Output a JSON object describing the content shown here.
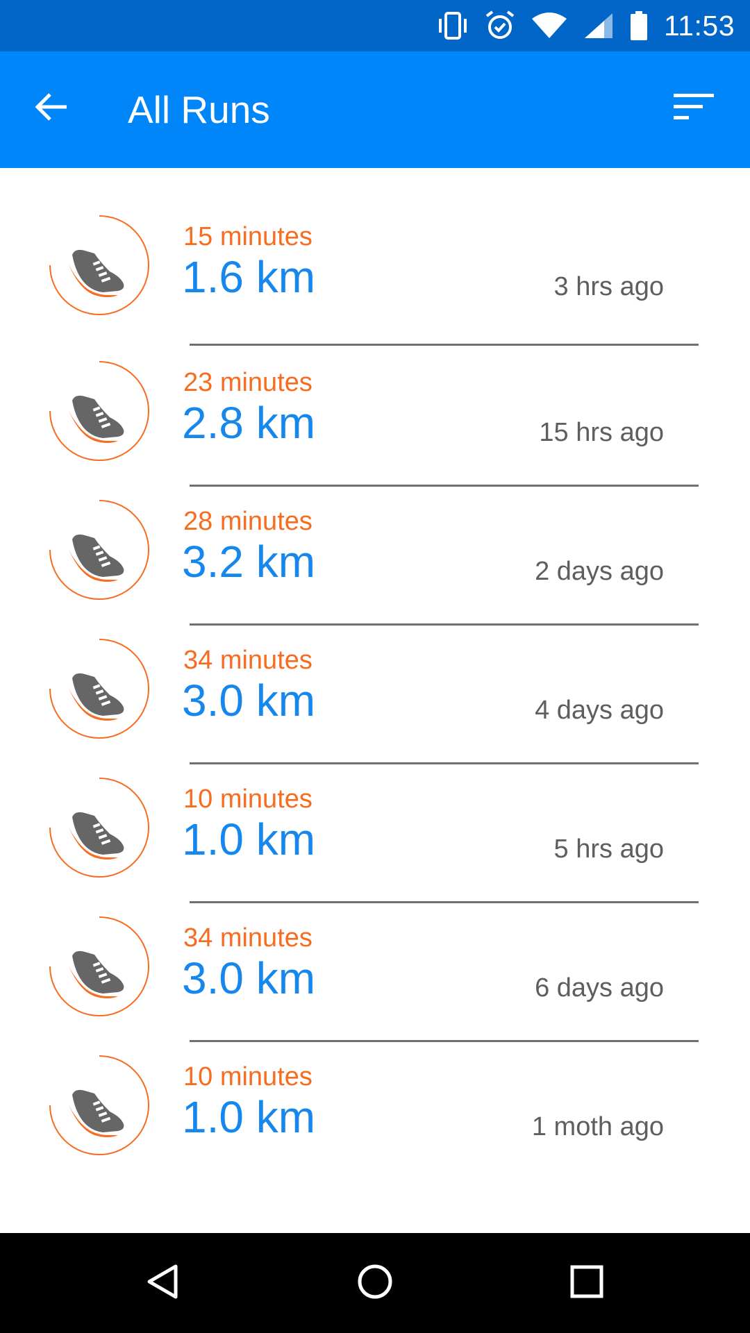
{
  "status_bar": {
    "time": "11:53",
    "icons": [
      "vibrate-icon",
      "alarm-icon",
      "wifi-icon",
      "signal-icon",
      "battery-icon"
    ]
  },
  "app_bar": {
    "title": "All Runs",
    "back_icon": "arrow-back-icon",
    "sort_icon": "sort-icon",
    "color": "#0186f9"
  },
  "runs": [
    {
      "duration": "15 minutes",
      "distance": "1.6 km",
      "time_ago": "3 hrs ago"
    },
    {
      "duration": "23 minutes",
      "distance": "2.8 km",
      "time_ago": "15 hrs ago"
    },
    {
      "duration": "28 minutes",
      "distance": "3.2 km",
      "time_ago": "2 days ago"
    },
    {
      "duration": "34 minutes",
      "distance": "3.0 km",
      "time_ago": "4 days ago"
    },
    {
      "duration": "10 minutes",
      "distance": "1.0 km",
      "time_ago": "5 hrs ago"
    },
    {
      "duration": "34 minutes",
      "distance": "3.0 km",
      "time_ago": "6 days ago"
    },
    {
      "duration": "10 minutes",
      "distance": "1.0 km",
      "time_ago": "1 moth ago"
    }
  ],
  "run_icon": "running-shoe-icon",
  "colors": {
    "status_bar": "#0166c8",
    "duration": "#f96b1e",
    "distance": "#1687ec",
    "time_ago": "#5e5e5e"
  },
  "nav_bar": {
    "icons": [
      "back-triangle-icon",
      "home-circle-icon",
      "recents-square-icon"
    ]
  }
}
